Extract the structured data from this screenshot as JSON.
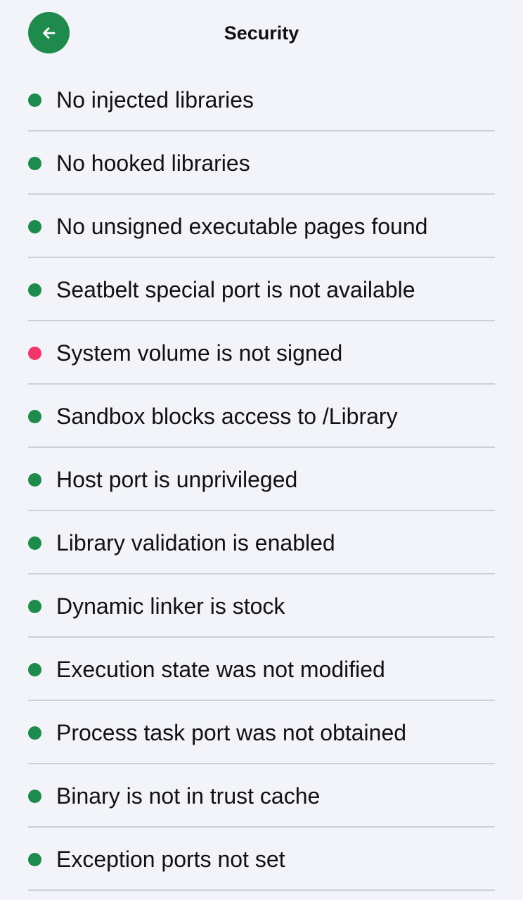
{
  "header": {
    "title": "Security",
    "back_icon": "arrow-left-icon"
  },
  "colors": {
    "accent": "#1e8a4c",
    "ok": "#1e8a4c",
    "fail": "#f0366b"
  },
  "checks": [
    {
      "label": "No injected libraries",
      "status": "ok"
    },
    {
      "label": "No hooked libraries",
      "status": "ok"
    },
    {
      "label": "No unsigned executable pages found",
      "status": "ok"
    },
    {
      "label": "Seatbelt special port is not available",
      "status": "ok"
    },
    {
      "label": "System volume is not signed",
      "status": "fail"
    },
    {
      "label": "Sandbox blocks access to /Library",
      "status": "ok"
    },
    {
      "label": "Host port is unprivileged",
      "status": "ok"
    },
    {
      "label": "Library validation is enabled",
      "status": "ok"
    },
    {
      "label": "Dynamic linker is stock",
      "status": "ok"
    },
    {
      "label": "Execution state was not modified",
      "status": "ok"
    },
    {
      "label": "Process task port was not obtained",
      "status": "ok"
    },
    {
      "label": "Binary is not in trust cache",
      "status": "ok"
    },
    {
      "label": "Exception ports not set",
      "status": "ok"
    }
  ]
}
